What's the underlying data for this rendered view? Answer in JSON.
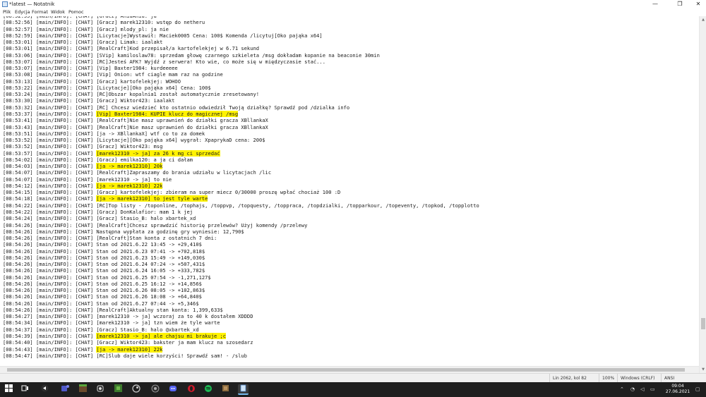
{
  "window": {
    "title": "*latest — Notatnik",
    "minimize_glyph": "—",
    "maximize_glyph": "❐",
    "close_glyph": "✕"
  },
  "menu": [
    "Plik",
    "Edycja",
    "Format",
    "Widok",
    "Pomoc"
  ],
  "lines": [
    "[08:52:55] [main/INFO]: [CHAT] [Gracz] AniaAnia: ja",
    "[08:52:56] [main/INFO]: [CHAT] [Gracz] marek12310: wstęp do netheru",
    "[08:52:57] [main/INFO]: [CHAT] [Gracz] mlody_pl: ja nie",
    "[08:52:59] [main/INFO]: [CHAT] [Licytacje]Wystawił: Maciek0005 Cena: 100$ Komenda /licytuj[Oko pająka x64]",
    "[08:53:01] [main/INFO]: [CHAT] [Gracz] Limak: iaalakt",
    "[08:53:01] [main/INFO]: [CHAT] [RealCraft]Kod przepisał/a kartofelekjej w 6.71 sekund",
    "[08:53:06] [main/INFO]: [CHAT] [SVip] kamiloslaw78: sprzedam głowę czarnego szkieleta /msg dokładam kopanie na beaconie 30min",
    "[08:53:07] [main/INFO]: [CHAT] [RC]Jesteś AFK? Wyjdź z serwera! Kto wie, co może się w międzyczasie stać...",
    "[08:53:07] [main/INFO]: [CHAT] [Vip] Baxter1984: kurdeeeee",
    "[08:53:08] [main/INFO]: [CHAT] [Vip] Onion: wtf ciagle mam raz na godzine",
    "[08:53:13] [main/INFO]: [CHAT] [Gracz] kartofelekjej: WOHOO",
    "[08:53:22] [main/INFO]: [CHAT] [Licytacje][Oko pająka x64] Cena: 100$",
    "[08:53:24] [main/INFO]: [CHAT] [RC]Obszar kopalnia1 został automatycznie zresetowany!",
    "[08:53:30] [main/INFO]: [CHAT] [Gracz] Wiktor423: iaalakt",
    "[08:53:32] [main/INFO]: [CHAT] [RC] Chcesz wiedzieć kto ostatnio odwiedził Twoją działkę? Sprawdź pod /dzialka info",
    "[08:53:37] [main/INFO]: [CHAT] [Vip] Baxter1984: KUPIE klucz do magicznej /msg",
    "[08:53:41] [main/INFO]: [CHAT] [RealCraft]Nie masz uprawnień do działki gracza XBllankaX",
    "[08:53:43] [main/INFO]: [CHAT] [RealCraft]Nie masz uprawnień do działki gracza XBllankaX",
    "[08:53:51] [main/INFO]: [CHAT] [ja -> XBllankaX] wtf co to za domek",
    "[08:53:52] [main/INFO]: [CHAT] [Licytacje][Oko pająka x64] wygrał: XpaprykaD cena: 200$",
    "[08:53:52] [main/INFO]: [CHAT] [Gracz] Wiktor423: msg",
    "[08:53:57] [main/INFO]: [CHAT] [marek12310 -> ja] za 26 k mg ci sprzedać",
    "[08:54:02] [main/INFO]: [CHAT] [Gracz] emilka120: a ja ci dałam",
    "[08:54:03] [main/INFO]: [CHAT] [ja -> marek12310] 20k",
    "[08:54:07] [main/INFO]: [CHAT] [RealCraft]Zapraszamy do brania udziału w licytacjach /lic",
    "[08:54:07] [main/INFO]: [CHAT] [marek12310 -> ja] to nie",
    "[08:54:12] [main/INFO]: [CHAT] [ja -> marek12310] 22k",
    "[08:54:15] [main/INFO]: [CHAT] [Gracz] kartofelekjej: zbieram na super miecz 0/30000 proszę wpłać chociaż 100 :D",
    "[08:54:18] [main/INFO]: [CHAT] [ja -> marek12310] to jest tyle warte",
    "[08:54:22] [main/INFO]: [CHAT] [RC]Top listy - /toponline, /tophajs, /toppvp, /topquesty, /toppraca, /topdzialki, /topparkour, /topeventy, /topkod, /topplotto",
    "[08:54:22] [main/INFO]: [CHAT] [Gracz] DonKalafior: mam 1 k jej",
    "[08:54:24] [main/INFO]: [CHAT] [Gracz] Stasio_B: halo xbartek_xd",
    "[08:54:26] [main/INFO]: [CHAT] [RealCraft]Chcesz sprawdzić historię przelewów? Użyj komendy /przelewy",
    "[08:54:26] [main/INFO]: [CHAT] Następna wypłata za godzinę gry wyniesie: 12,790$",
    "[08:54:26] [main/INFO]: [CHAT] [RealCraft]Stan konta z ostatnich 7 dni:",
    "[08:54:26] [main/INFO]: [CHAT] Stan od 2021.6.22 13:45 -> +29,410$",
    "[08:54:26] [main/INFO]: [CHAT] Stan od 2021.6.23 07:41 -> +702,818$",
    "[08:54:26] [main/INFO]: [CHAT] Stan od 2021.6.23 15:49 -> +149,030$",
    "[08:54:26] [main/INFO]: [CHAT] Stan od 2021.6.24 07:24 -> +507,431$",
    "[08:54:26] [main/INFO]: [CHAT] Stan od 2021.6.24 16:05 -> +333,782$",
    "[08:54:26] [main/INFO]: [CHAT] Stan od 2021.6.25 07:54 -> -1,271,127$",
    "[08:54:26] [main/INFO]: [CHAT] Stan od 2021.6.25 16:12 -> +14,856$",
    "[08:54:26] [main/INFO]: [CHAT] Stan od 2021.6.26 08:05 -> +102,863$",
    "[08:54:26] [main/INFO]: [CHAT] Stan od 2021.6.26 18:08 -> +64,840$",
    "[08:54:26] [main/INFO]: [CHAT] Stan od 2021.6.27 07:44 -> +5,346$",
    "[08:54:26] [main/INFO]: [CHAT] [RealCraft]Aktualny stan konta: 1,399,633$",
    "[08:54:27] [main/INFO]: [CHAT] [marek12310 -> ja] wczoraj za to 40 k dostałem XDDDD",
    "[08:54:34] [main/INFO]: [CHAT] [marek12310 -> ja] tzn wiem że tyle warte",
    "[08:54:37] [main/INFO]: [CHAT] [Gracz] Stasio_B: halo @xbartek_xd",
    "[08:54:39] [main/INFO]: [CHAT] [marek12310 -> ja] ale chajsu mi brakuje ;c",
    "[08:54:40] [main/INFO]: [CHAT] [Gracz] Wiktor423: bakster ja mam klucz na szosedarz",
    "[08:54:43] [main/INFO]: [CHAT] [ja -> marek12310] 22k",
    "[08:54:47] [main/INFO]: [CHAT] [RC]Ślub daje wiele korzyści! Sprawdź sam! - /slub"
  ],
  "highlight_color": "#fff200",
  "status": {
    "position": "Lin 2062, kol 82",
    "zoom": "100%",
    "line_endings": "Windows (CRLF)",
    "encoding": "ANSI"
  },
  "taskbar": {
    "start_icon": "windows-start-icon",
    "apps": [
      "task-view-icon",
      "chrome-icon",
      "teams-icon",
      "minecraft-icon",
      "sound-icon",
      "minecraft-launcher-icon",
      "steam-icon",
      "chrome-icon-2",
      "discord-icon",
      "opera-icon",
      "spotify-icon",
      "file-icon",
      "notepad-icon"
    ],
    "time": "09:04",
    "date": "27.06.2021"
  }
}
